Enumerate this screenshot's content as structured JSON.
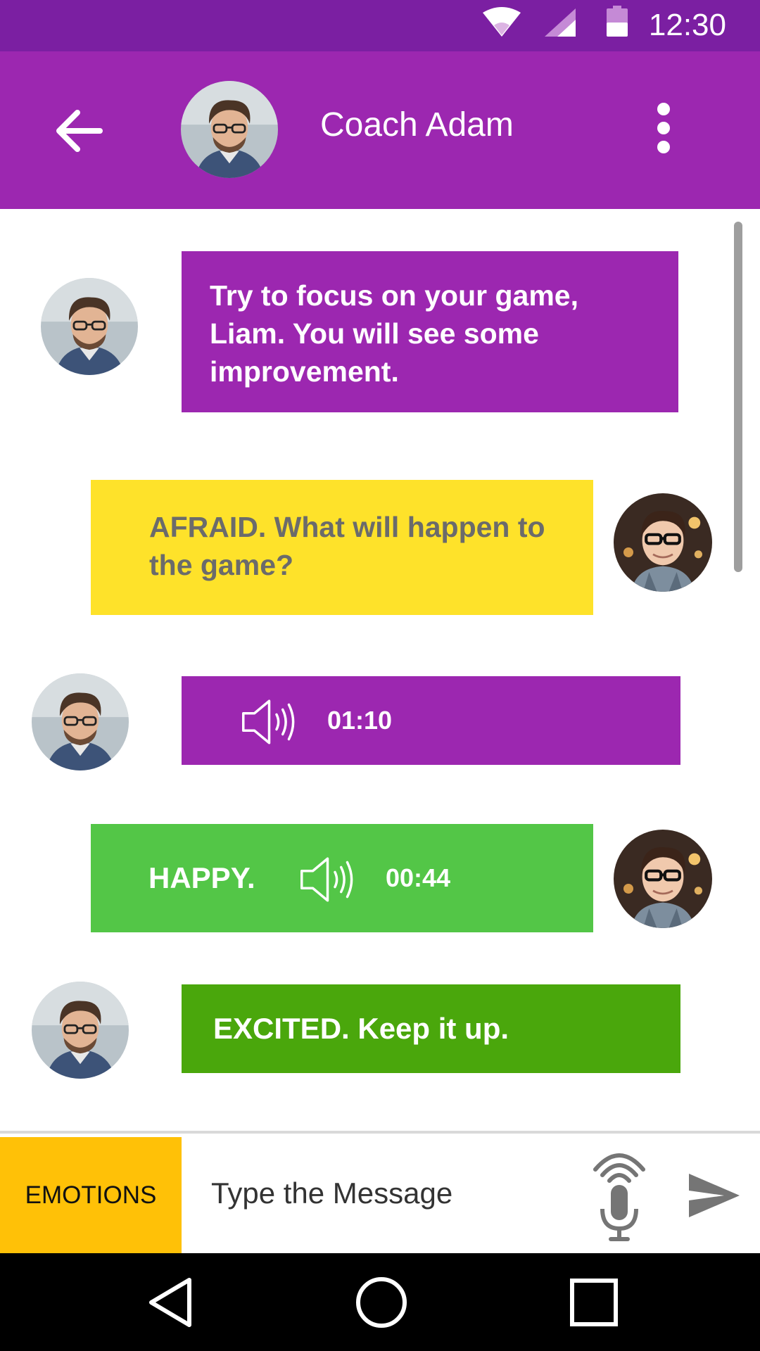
{
  "status_bar": {
    "time": "12:30",
    "icons": [
      "wifi-icon",
      "cellular-signal-icon",
      "battery-icon"
    ]
  },
  "header": {
    "title": "Coach Adam",
    "back_icon": "arrow-back-icon",
    "more_icon": "more-vert-icon",
    "color": "#9c27b0"
  },
  "messages": [
    {
      "sender": "coach",
      "type": "text",
      "text": "Try to focus on your game, Liam. You will see some improvement.",
      "color": "#9c27b0"
    },
    {
      "sender": "user",
      "type": "text",
      "text": "AFRAID. What will happen to the game?",
      "color": "#fee22a"
    },
    {
      "sender": "coach",
      "type": "audio",
      "duration": "01:10",
      "color": "#9c27b0"
    },
    {
      "sender": "user",
      "type": "audio",
      "emotion": "HAPPY.",
      "duration": "00:44",
      "color": "#53c647"
    },
    {
      "sender": "coach",
      "type": "text",
      "text": "EXCITED. Keep it up.",
      "color": "#4aa70c"
    }
  ],
  "input_bar": {
    "emotions_label": "EMOTIONS",
    "placeholder": "Type the Message",
    "emotions_color": "#ffc107",
    "mic_icon": "microphone-icon",
    "send_icon": "send-icon"
  },
  "nav_bar": {
    "icons": [
      "nav-back-icon",
      "nav-home-icon",
      "nav-recents-icon"
    ]
  }
}
